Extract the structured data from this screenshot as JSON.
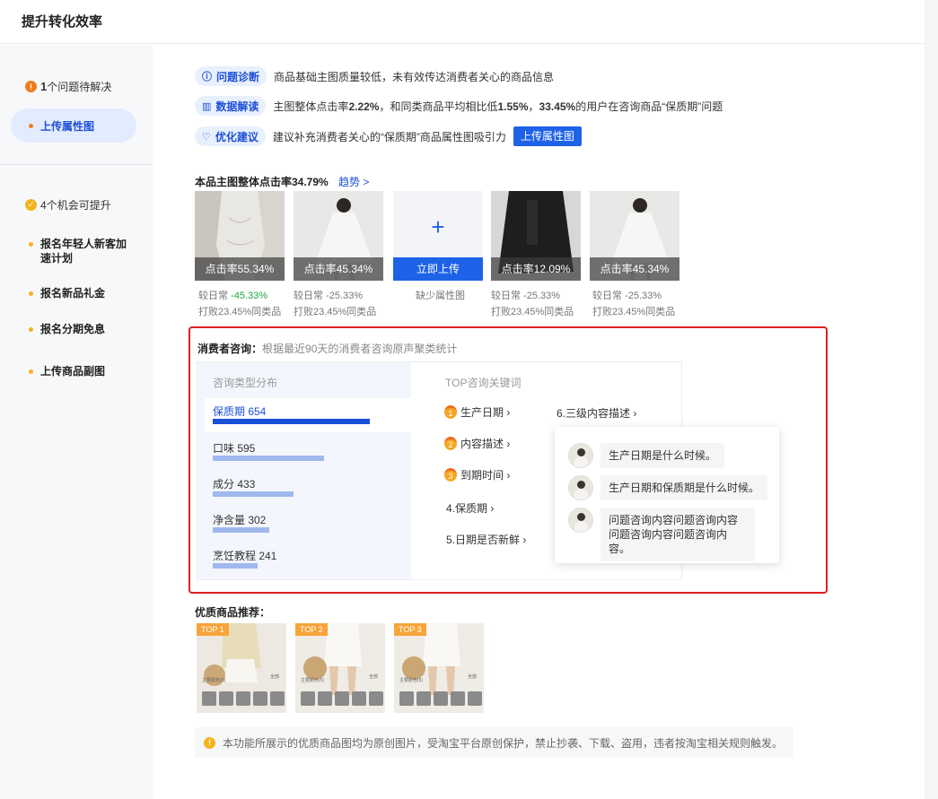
{
  "header": {
    "title": "提升转化效率"
  },
  "sidebar": {
    "issues": {
      "count": "1",
      "label": "个问题待解决",
      "active_item": "上传属性图"
    },
    "opportunities": {
      "count": "4",
      "label": "个机会可提升",
      "items": [
        "报名年轻人新客加速计划",
        "报名新品礼金",
        "报名分期免息",
        "上传商品副图"
      ]
    }
  },
  "diagnosis": {
    "problem": {
      "tag": "问题诊断",
      "text": "商品基础主图质量较低，未有效传达消费者关心的商品信息"
    },
    "data": {
      "tag": "数据解读",
      "text_a": "主图整体点击率",
      "v1": "2.22%",
      "text_b": "，和同类商品平均相比低",
      "v2": "1.55%",
      "text_c": "，",
      "v3": "33.45%",
      "text_d": "的用户在咨询商品“保质期”问题"
    },
    "suggest": {
      "tag": "优化建议",
      "text": "建议补充消费者关心的“保质期”商品属性图吸引力",
      "button": "上传属性图"
    }
  },
  "click_rate": {
    "title": "本品主图整体点击率34.79%",
    "trend_link": "趋势 >",
    "thumbs": [
      {
        "overlay": "点击率55.34%",
        "cap1_prefix": "较日常 ",
        "cap1_val": "-45.33%",
        "cap1_green": true,
        "cap2": "打败23.45%同类品"
      },
      {
        "overlay": "点击率45.34%",
        "cap1_prefix": "较日常 ",
        "cap1_val": "-25.33%",
        "cap1_green": false,
        "cap2": "打败23.45%同类品"
      },
      {
        "overlay": "立即上传",
        "is_upload": true,
        "cap1_prefix": "缺少属性图",
        "cap1_val": "",
        "cap2": ""
      },
      {
        "overlay": "点击率12.09%",
        "cap1_prefix": "较日常 ",
        "cap1_val": "-25.33%",
        "cap1_green": false,
        "cap2": "打败23.45%同类品"
      },
      {
        "overlay": "点击率45.34%",
        "cap1_prefix": "较日常 ",
        "cap1_val": "-25.33%",
        "cap1_green": false,
        "cap2": "打败23.45%同类品"
      }
    ]
  },
  "consumer": {
    "title": "消费者咨询：",
    "subtitle": "根据最近90天的消费者咨询原声聚类统计",
    "dist_header": "咨询类型分布",
    "categories": [
      {
        "label": "保质期  654",
        "value": 654
      },
      {
        "label": "口味  595",
        "value": 595
      },
      {
        "label": "成分 433",
        "value": 433
      },
      {
        "label": "净含量 302",
        "value": 302
      },
      {
        "label": "烹饪教程 241",
        "value": 241
      }
    ],
    "kw_header": "TOP咨询关键词",
    "keywords": [
      "生产日期 ›",
      "内容描述 ›",
      "到期时间 ›",
      "4.保质期 ›",
      "5.日期是否新鲜 ›",
      "6.三级内容描述 ›"
    ],
    "questions": [
      "生产日期是什么时候。",
      "生产日期和保质期是什么时候。",
      "问题咨询内容问题咨询内容问题咨询内容问题咨询内容。"
    ]
  },
  "recommend": {
    "title": "优质商品推荐：",
    "badges": [
      "TOP 1",
      "TOP 2",
      "TOP 3"
    ],
    "meta_left": "主要颜色(5)",
    "meta_right": "全部"
  },
  "notice": {
    "text": "本功能所展示的优质商品图均为原创图片，受淘宝平台原创保护，禁止抄袭、下载、盗用，违者按淘宝相关规则触发。"
  }
}
